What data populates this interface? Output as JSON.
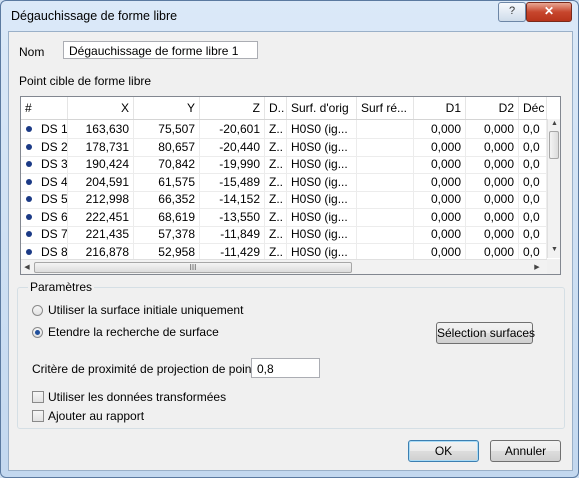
{
  "window": {
    "title": "Dégauchissage de forme libre",
    "help_label": "?",
    "close_label": "✕"
  },
  "name": {
    "label": "Nom",
    "value": "Dégauchissage de forme libre 1"
  },
  "points_label": "Point cible de forme libre",
  "grid": {
    "columns": [
      "#",
      "X",
      "Y",
      "Z",
      "D..",
      "Surf. d'orig",
      "Surf ré...",
      "D1",
      "D2",
      "Déc"
    ],
    "rows": [
      {
        "id": "DS 1",
        "x": "163,630",
        "y": "75,507",
        "z": "-20,601",
        "d": "Z..",
        "surf_orig": "H0S0 (ig...",
        "surf_re": "",
        "d1": "0,000",
        "d2": "0,000",
        "dec": "0,0"
      },
      {
        "id": "DS 2",
        "x": "178,731",
        "y": "80,657",
        "z": "-20,440",
        "d": "Z..",
        "surf_orig": "H0S0 (ig...",
        "surf_re": "",
        "d1": "0,000",
        "d2": "0,000",
        "dec": "0,0"
      },
      {
        "id": "DS 3",
        "x": "190,424",
        "y": "70,842",
        "z": "-19,990",
        "d": "Z..",
        "surf_orig": "H0S0 (ig...",
        "surf_re": "",
        "d1": "0,000",
        "d2": "0,000",
        "dec": "0,0"
      },
      {
        "id": "DS 4",
        "x": "204,591",
        "y": "61,575",
        "z": "-15,489",
        "d": "Z..",
        "surf_orig": "H0S0 (ig...",
        "surf_re": "",
        "d1": "0,000",
        "d2": "0,000",
        "dec": "0,0"
      },
      {
        "id": "DS 5",
        "x": "212,998",
        "y": "66,352",
        "z": "-14,152",
        "d": "Z..",
        "surf_orig": "H0S0 (ig...",
        "surf_re": "",
        "d1": "0,000",
        "d2": "0,000",
        "dec": "0,0"
      },
      {
        "id": "DS 6",
        "x": "222,451",
        "y": "68,619",
        "z": "-13,550",
        "d": "Z..",
        "surf_orig": "H0S0 (ig...",
        "surf_re": "",
        "d1": "0,000",
        "d2": "0,000",
        "dec": "0,0"
      },
      {
        "id": "DS 7",
        "x": "221,435",
        "y": "57,378",
        "z": "-11,849",
        "d": "Z..",
        "surf_orig": "H0S0 (ig...",
        "surf_re": "",
        "d1": "0,000",
        "d2": "0,000",
        "dec": "0,0"
      },
      {
        "id": "DS 8",
        "x": "216,878",
        "y": "52,958",
        "z": "-11,429",
        "d": "Z..",
        "surf_orig": "H0S0 (ig...",
        "surf_re": "",
        "d1": "0,000",
        "d2": "0,000",
        "dec": "0,0"
      }
    ],
    "hscroll_thumb_grip": "III"
  },
  "parameters": {
    "title": "Paramètres",
    "radio_initial_surface": "Utiliser la surface initiale uniquement",
    "radio_extend_search": "Etendre la recherche de surface",
    "selected_radio": "extend",
    "surface_selection_button": "Sélection surfaces",
    "proximity_label": "Critère de proximité de projection de point",
    "proximity_value": "0,8",
    "use_transformed_label": "Utiliser les données transformées",
    "use_transformed_checked": false,
    "add_report_label": "Ajouter au rapport",
    "add_report_checked": false
  },
  "buttons": {
    "ok": "OK",
    "cancel": "Annuler"
  }
}
